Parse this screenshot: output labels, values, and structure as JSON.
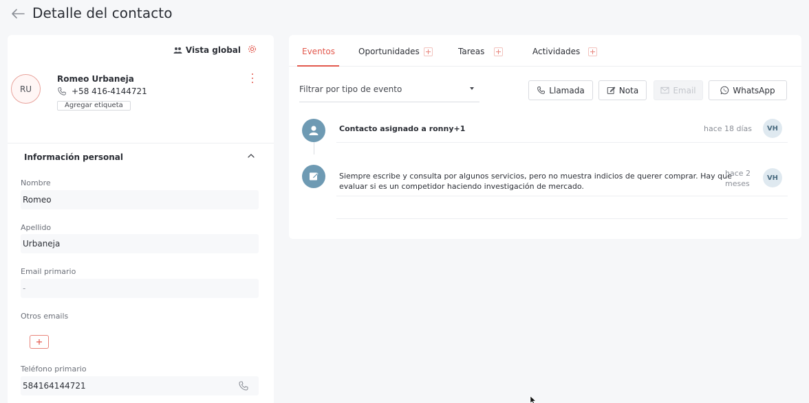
{
  "header": {
    "title": "Detalle del contacto"
  },
  "left": {
    "global_view": "Vista global",
    "contact": {
      "initials": "RU",
      "name": "Romeo Urbaneja",
      "phone": "+58 416-4144721",
      "tag_button": "Agregar etiqueta"
    },
    "section_title": "Información personal",
    "fields": {
      "nombre_label": "Nombre",
      "nombre_value": "Romeo",
      "apellido_label": "Apellido",
      "apellido_value": "Urbaneja",
      "email_label": "Email primario",
      "email_value": "-",
      "otros_label": "Otros emails",
      "telefono_label": "Teléfono primario",
      "telefono_value": "584164144721"
    }
  },
  "right": {
    "tabs": [
      "Eventos",
      "Oportunidades",
      "Tareas",
      "Actividades"
    ],
    "filter_placeholder": "Filtrar por tipo de evento",
    "actions": {
      "call": "Llamada",
      "note": "Nota",
      "email": "Email",
      "whatsapp": "WhatsApp"
    },
    "events": [
      {
        "text_prefix": "Contacto asignado a ",
        "text_target": "ronny+1",
        "time": "hace 18 días",
        "badge": "VH"
      },
      {
        "text_line1": "Siempre escribe y consulta por algunos servicios, pero no muestra indicios de querer comprar. Hay que",
        "text_line2": "evaluar si es un competidor haciendo investigación de mercado.",
        "time_line1": "hace 2",
        "time_line2": "meses",
        "badge": "VH"
      }
    ]
  },
  "colors": {
    "accent": "#e2574c",
    "event_avatar": "#6e9ab3"
  }
}
